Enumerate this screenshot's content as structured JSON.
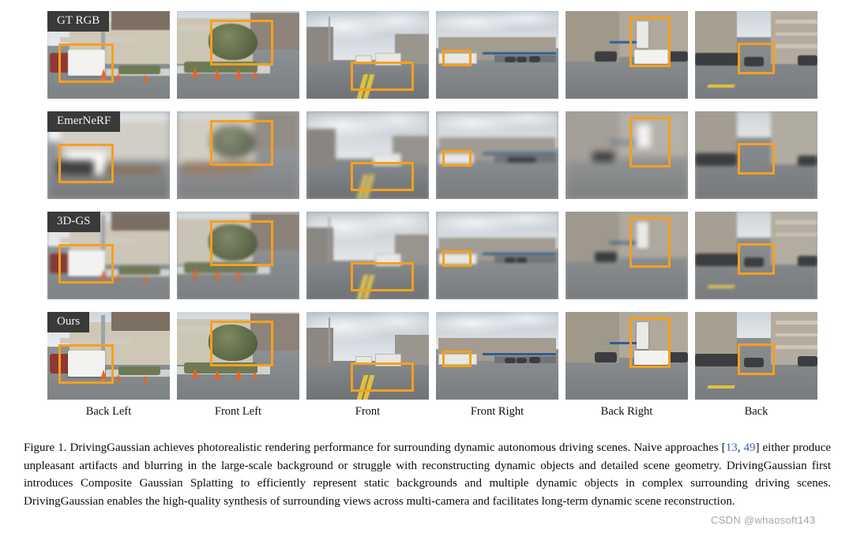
{
  "figure": {
    "row_labels": [
      "GT RGB",
      "EmerNeRF",
      "3D-GS",
      "Ours"
    ],
    "column_labels": [
      "Back Left",
      "Front Left",
      "Front",
      "Front Right",
      "Back Right",
      "Back"
    ],
    "highlight_color": "#F5A01E",
    "label_background": "#3A3A3A",
    "label_text_color": "#F2F2F2",
    "citation_color": "#3A62C4",
    "rows": 4,
    "columns": 6
  },
  "caption": {
    "label": "Figure 1.",
    "part1": "DrivingGaussian achieves photorealistic rendering performance for surrounding dynamic autonomous driving scenes. Naive approaches [",
    "cite1": "13",
    "sep": ", ",
    "cite2": "49",
    "part2": "] either produce unpleasant artifacts and blurring in the large-scale background or struggle with reconstructing dynamic objects and detailed scene geometry. DrivingGaussian first introduces Composite Gaussian Splatting to efficiently represent static backgrounds and multiple dynamic objects in complex surrounding driving scenes. DrivingGaussian enables the high-quality synthesis of surrounding views across multi-camera and facilitates long-term dynamic scene reconstruction."
  },
  "watermark": {
    "text": "CSDN @whaosoft143"
  }
}
